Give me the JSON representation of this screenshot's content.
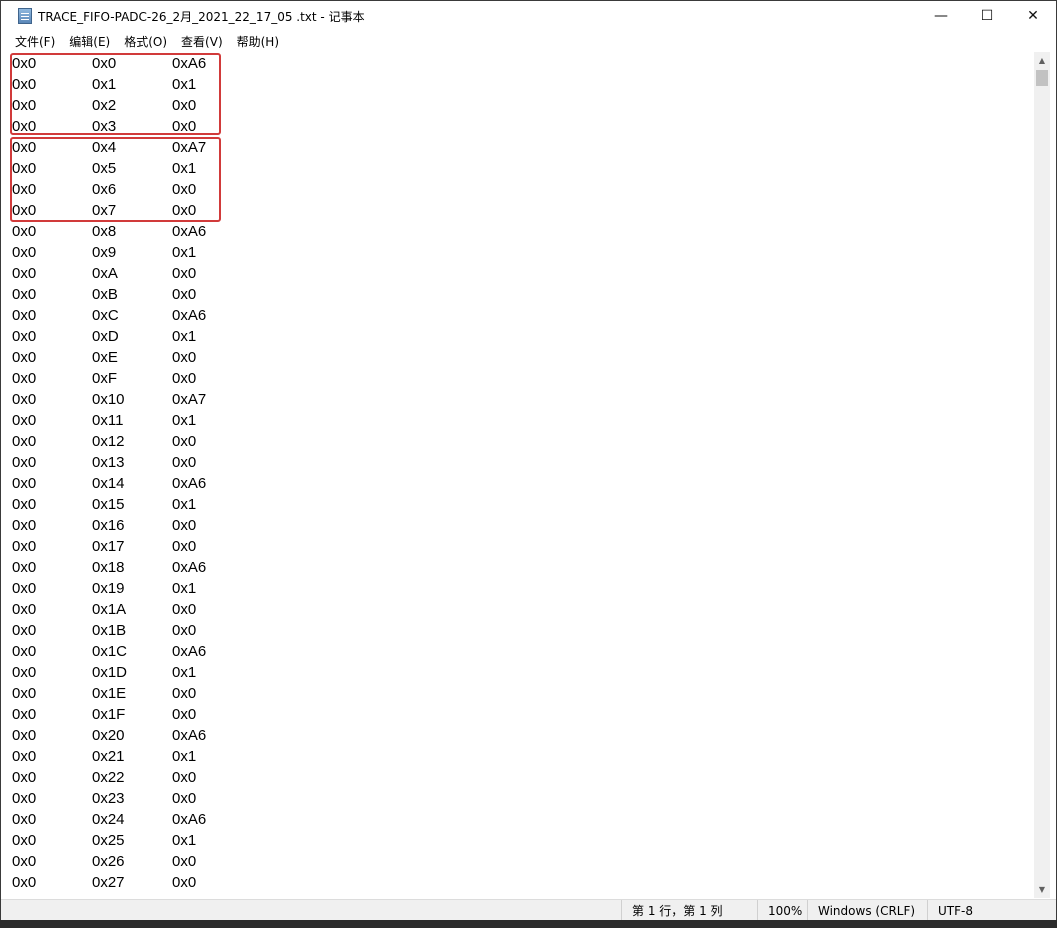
{
  "window": {
    "title": "TRACE_FIFO-PADC-26_2月_2021_22_17_05 .txt - 记事本",
    "icon": "notepad-icon",
    "controls": {
      "minimize": "—",
      "maximize": "☐",
      "close": "✕"
    }
  },
  "menu": [
    "文件(F)",
    "编辑(E)",
    "格式(O)",
    "查看(V)",
    "帮助(H)"
  ],
  "rows": [
    [
      "0x0",
      "0x0",
      "0xA6"
    ],
    [
      "0x0",
      "0x1",
      "0x1"
    ],
    [
      "0x0",
      "0x2",
      "0x0"
    ],
    [
      "0x0",
      "0x3",
      "0x0"
    ],
    [
      "0x0",
      "0x4",
      "0xA7"
    ],
    [
      "0x0",
      "0x5",
      "0x1"
    ],
    [
      "0x0",
      "0x6",
      "0x0"
    ],
    [
      "0x0",
      "0x7",
      "0x0"
    ],
    [
      "0x0",
      "0x8",
      "0xA6"
    ],
    [
      "0x0",
      "0x9",
      "0x1"
    ],
    [
      "0x0",
      "0xA",
      "0x0"
    ],
    [
      "0x0",
      "0xB",
      "0x0"
    ],
    [
      "0x0",
      "0xC",
      "0xA6"
    ],
    [
      "0x0",
      "0xD",
      "0x1"
    ],
    [
      "0x0",
      "0xE",
      "0x0"
    ],
    [
      "0x0",
      "0xF",
      "0x0"
    ],
    [
      "0x0",
      "0x10",
      "0xA7"
    ],
    [
      "0x0",
      "0x11",
      "0x1"
    ],
    [
      "0x0",
      "0x12",
      "0x0"
    ],
    [
      "0x0",
      "0x13",
      "0x0"
    ],
    [
      "0x0",
      "0x14",
      "0xA6"
    ],
    [
      "0x0",
      "0x15",
      "0x1"
    ],
    [
      "0x0",
      "0x16",
      "0x0"
    ],
    [
      "0x0",
      "0x17",
      "0x0"
    ],
    [
      "0x0",
      "0x18",
      "0xA6"
    ],
    [
      "0x0",
      "0x19",
      "0x1"
    ],
    [
      "0x0",
      "0x1A",
      "0x0"
    ],
    [
      "0x0",
      "0x1B",
      "0x0"
    ],
    [
      "0x0",
      "0x1C",
      "0xA6"
    ],
    [
      "0x0",
      "0x1D",
      "0x1"
    ],
    [
      "0x0",
      "0x1E",
      "0x0"
    ],
    [
      "0x0",
      "0x1F",
      "0x0"
    ],
    [
      "0x0",
      "0x20",
      "0xA6"
    ],
    [
      "0x0",
      "0x21",
      "0x1"
    ],
    [
      "0x0",
      "0x22",
      "0x0"
    ],
    [
      "0x0",
      "0x23",
      "0x0"
    ],
    [
      "0x0",
      "0x24",
      "0xA6"
    ],
    [
      "0x0",
      "0x25",
      "0x1"
    ],
    [
      "0x0",
      "0x26",
      "0x0"
    ],
    [
      "0x0",
      "0x27",
      "0x0"
    ]
  ],
  "highlight_color": "#d13a3a",
  "status": {
    "position": "第 1 行，第 1 列",
    "zoom": "100%",
    "line_ending": "Windows (CRLF)",
    "encoding": "UTF-8"
  }
}
